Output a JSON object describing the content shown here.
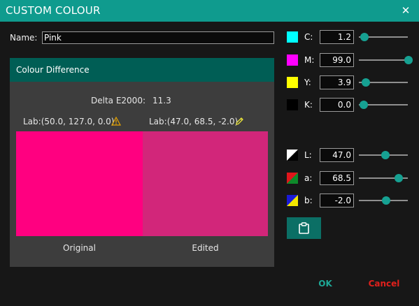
{
  "window": {
    "title": "CUSTOM COLOUR",
    "close_glyph": "✕"
  },
  "name": {
    "label": "Name:",
    "value": "Pink"
  },
  "difference": {
    "title": "Colour Difference",
    "delta_label": "Delta E2000:",
    "delta_value": "11.3",
    "original_lab": "Lab:(50.0, 127.0, 0.0)",
    "edited_lab": "Lab:(47.0, 68.5, -2.0)",
    "original_caption": "Original",
    "edited_caption": "Edited",
    "original_color": "#ff0080",
    "edited_color": "#d2267a"
  },
  "cmyk": [
    {
      "label": "C:",
      "value": "1.2",
      "color": "#00ffff",
      "level": 0.012
    },
    {
      "label": "M:",
      "value": "99.0",
      "color": "#ff00ff",
      "level": 0.99
    },
    {
      "label": "Y:",
      "value": "3.9",
      "color": "#ffff00",
      "level": 0.039
    },
    {
      "label": "K:",
      "value": "0.0",
      "color": "#000000",
      "level": 0.0
    }
  ],
  "lab": [
    {
      "label": "L:",
      "value": "47.0",
      "icon": "l-channel-icon",
      "level": 0.47
    },
    {
      "label": "a:",
      "value": "68.5",
      "icon": "a-channel-icon",
      "level": 0.77
    },
    {
      "label": "b:",
      "value": "-2.0",
      "icon": "b-channel-icon",
      "level": 0.49
    }
  ],
  "actions": {
    "ok": "OK",
    "cancel": "Cancel"
  },
  "colors": {
    "title_bar": "#0f9b8e",
    "panel_header": "#005e55",
    "accent": "#16a192",
    "cancel": "#e0201c",
    "warning": "#e8a400",
    "edit": "#e8e23a"
  }
}
